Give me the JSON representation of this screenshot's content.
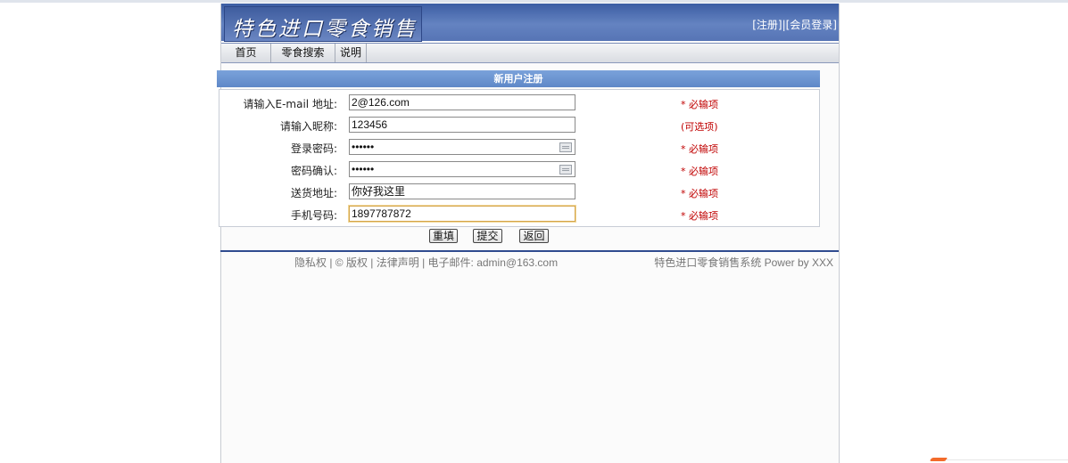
{
  "header": {
    "logo_text": "特色进口零食销售",
    "register_link": "[注册]",
    "separator": "|",
    "login_link": "[会员登录]"
  },
  "nav": {
    "items": [
      {
        "label": "首页"
      },
      {
        "label": "零食搜索"
      },
      {
        "label": "说明"
      }
    ]
  },
  "form": {
    "title": "新用户注册",
    "rows": [
      {
        "label": "请输入E-mail 地址:",
        "value": "2@126.com",
        "note": "* 必输项",
        "type": "text"
      },
      {
        "label": "请输入昵称:",
        "value": "123456",
        "note": "(可选项)",
        "type": "text"
      },
      {
        "label": "登录密码:",
        "value": "••••••",
        "note": "* 必输项",
        "type": "password"
      },
      {
        "label": "密码确认:",
        "value": "••••••",
        "note": "* 必输项",
        "type": "password"
      },
      {
        "label": "送货地址:",
        "value": "你好我这里",
        "note": "* 必输项",
        "type": "text"
      },
      {
        "label": "手机号码:",
        "value": "1897787872",
        "note": "* 必输项",
        "type": "text"
      }
    ],
    "buttons": {
      "reset": "重填",
      "submit": "提交",
      "back": "返回"
    }
  },
  "footer": {
    "left": "隐私权 | © 版权 | 法律声明 | 电子邮件: admin@163.com",
    "right": "特色进口零食销售系统  Power by XXX"
  },
  "colors": {
    "banner": "#4e6db0",
    "section_title": "#6c94d0",
    "note_red": "#c00000",
    "footer_line": "#2f4b8f"
  }
}
